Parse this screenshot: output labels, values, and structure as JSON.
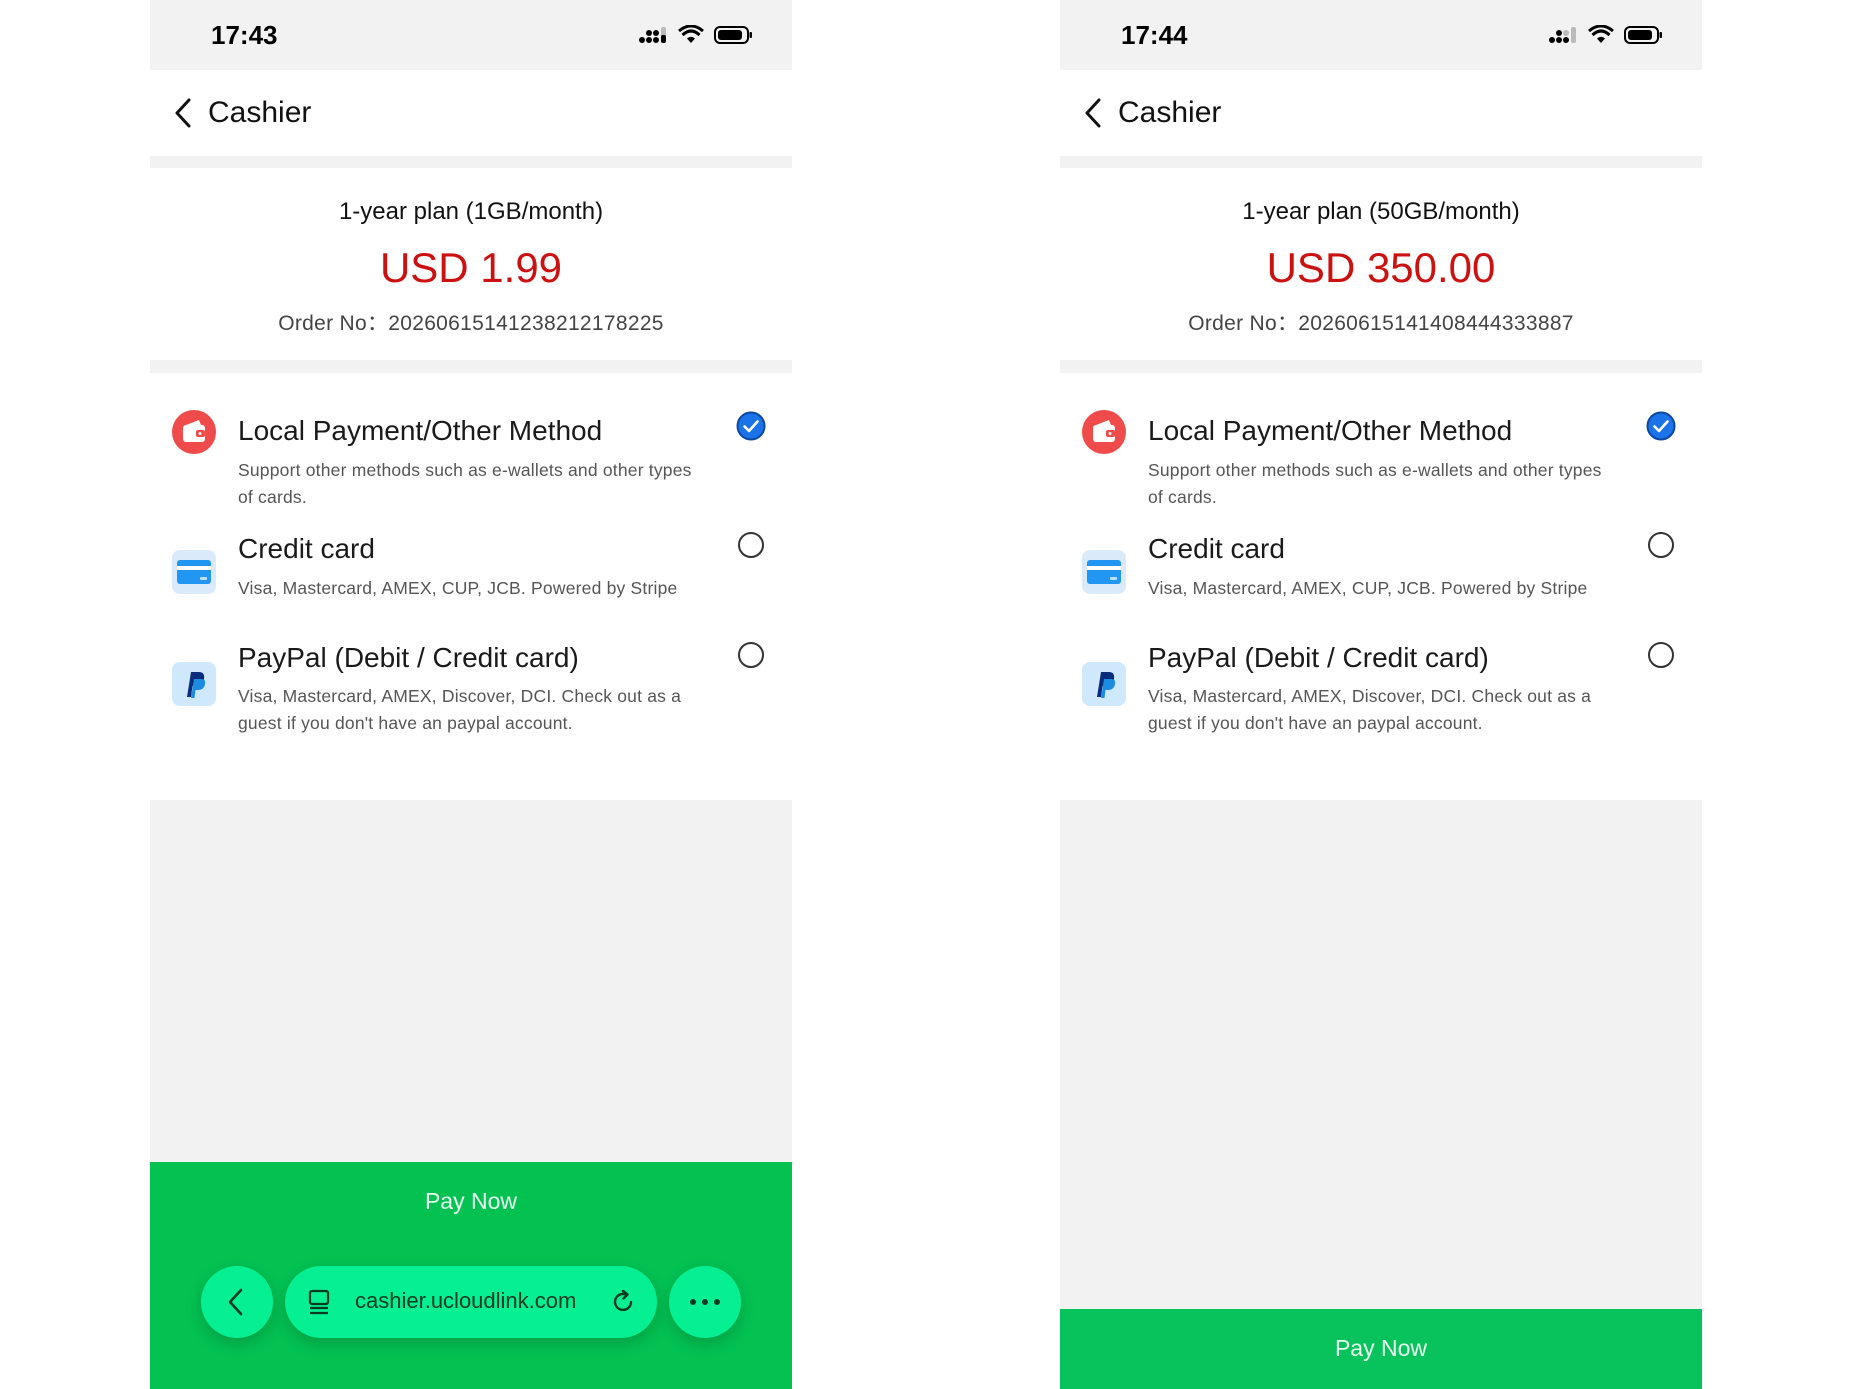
{
  "screens": [
    {
      "status": {
        "time": "17:43"
      },
      "nav": {
        "title": "Cashier"
      },
      "summary": {
        "plan": "1-year plan (1GB/month)",
        "price": "USD 1.99",
        "order": "Order No：20260615141238212178225"
      },
      "methods": [
        {
          "title": "Local Payment/Other Method",
          "desc": "Support other methods such as e-wallets and other types of cards.",
          "selected": true,
          "icon": "wallet-icon"
        },
        {
          "title": "Credit card",
          "desc": "Visa, Mastercard, AMEX, CUP, JCB. Powered by Stripe",
          "selected": false,
          "icon": "credit-card-icon"
        },
        {
          "title": "PayPal (Debit / Credit card)",
          "desc": "Visa, Mastercard, AMEX, Discover, DCI. Check out as a guest if you don't have an paypal account.",
          "selected": false,
          "icon": "paypal-icon"
        }
      ],
      "pay_label": "Pay Now",
      "browser": {
        "url": "cashier.ucloudlink.com"
      }
    },
    {
      "status": {
        "time": "17:44"
      },
      "nav": {
        "title": "Cashier"
      },
      "summary": {
        "plan": "1-year plan (50GB/month)",
        "price": "USD 350.00",
        "order": "Order No：20260615141408444333887"
      },
      "methods": [
        {
          "title": "Local Payment/Other Method",
          "desc": "Support other methods such as e-wallets and other types of cards.",
          "selected": true,
          "icon": "wallet-icon"
        },
        {
          "title": "Credit card",
          "desc": "Visa, Mastercard, AMEX, CUP, JCB. Powered by Stripe",
          "selected": false,
          "icon": "credit-card-icon"
        },
        {
          "title": "PayPal (Debit / Credit card)",
          "desc": "Visa, Mastercard, AMEX, Discover, DCI. Check out as a guest if you don't have an paypal account.",
          "selected": false,
          "icon": "paypal-icon"
        }
      ],
      "pay_label": "Pay Now"
    }
  ],
  "colors": {
    "price": "#cc1111",
    "pay_button": "#08c35c",
    "browser_pill": "#06f093",
    "radio_checked": "#1a73e8"
  }
}
